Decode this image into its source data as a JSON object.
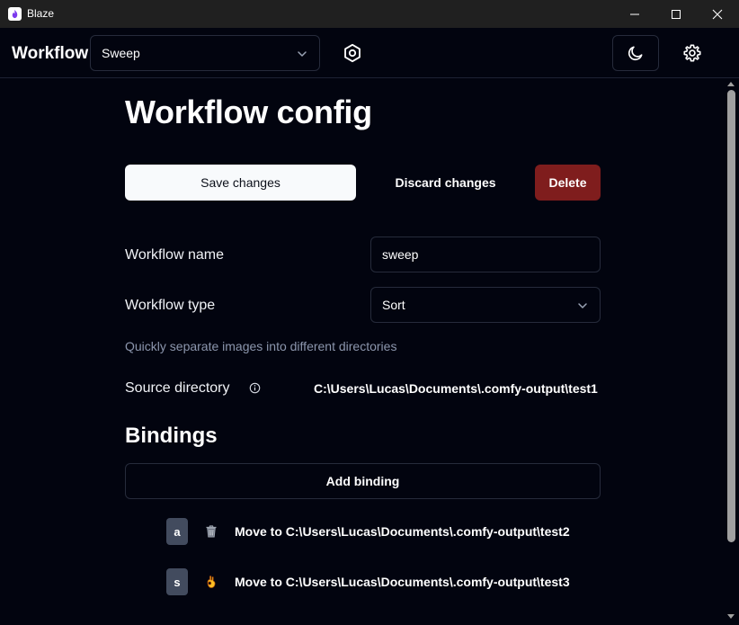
{
  "window": {
    "title": "Blaze",
    "icons": {
      "app": "flame-icon",
      "minimize": "minimize-icon",
      "maximize": "maximize-icon",
      "close": "close-icon"
    }
  },
  "header": {
    "brand": "Workflow",
    "workflow_select": {
      "value": "Sweep",
      "icon": "chevron-down-icon"
    },
    "icons": {
      "workflows": "hexagon-icon",
      "theme": "moon-icon",
      "settings": "gear-icon"
    }
  },
  "main": {
    "title": "Workflow config",
    "buttons": {
      "save": "Save changes",
      "discard": "Discard changes",
      "delete": "Delete"
    },
    "form": {
      "name_label": "Workflow name",
      "name_value": "sweep",
      "type_label": "Workflow type",
      "type_value": "Sort",
      "type_description": "Quickly separate images into different directories",
      "source_label": "Source directory",
      "source_info_icon": "info-icon",
      "source_value": "C:\\Users\\Lucas\\Documents\\.comfy-output\\test1"
    },
    "bindings": {
      "title": "Bindings",
      "add_label": "Add binding",
      "items": [
        {
          "key": "a",
          "icon": "trash-icon",
          "action": "Move to C:\\Users\\Lucas\\Documents\\.comfy-output\\test2"
        },
        {
          "key": "s",
          "icon": "ok-hand-icon",
          "action": "Move to C:\\Users\\Lucas\\Documents\\.comfy-output\\test3"
        }
      ]
    }
  },
  "colors": {
    "background": "#02040f",
    "titlebar": "#202020",
    "delete": "#7f1d1d",
    "border": "#262b3b",
    "muted_text": "#8c96ad",
    "key_badge": "#424b5e"
  }
}
